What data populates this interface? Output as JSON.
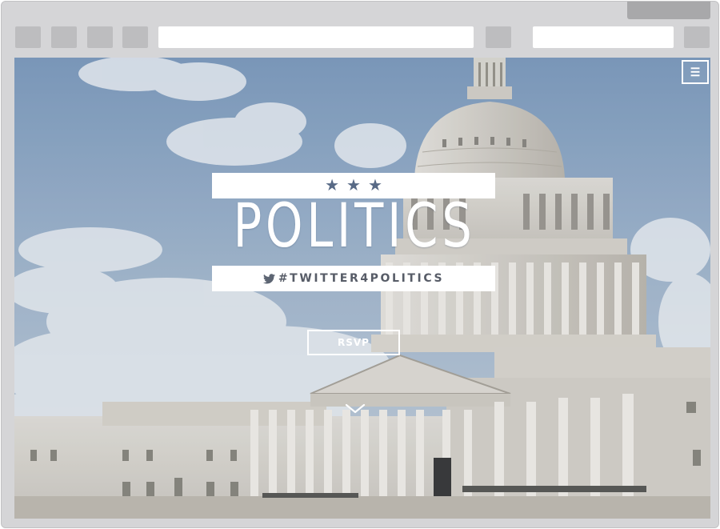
{
  "browser": {
    "address_value": "",
    "search_value": ""
  },
  "page": {
    "menu_icon": "hamburger-icon",
    "stars": [
      "★",
      "★",
      "★"
    ],
    "title": "POLITICS",
    "hashtag": "#TWITTER4POLITICS",
    "hashtag_icon": "twitter-bird-icon",
    "rsvp_label": "RSVP",
    "scroll_icon": "chevron-down-icon"
  },
  "colors": {
    "frame": "#d5d5d7",
    "toolbar_button": "#bdbdbf",
    "star": "#586a86",
    "hashtag_text": "#575c67",
    "overlay_text": "#ffffff"
  }
}
